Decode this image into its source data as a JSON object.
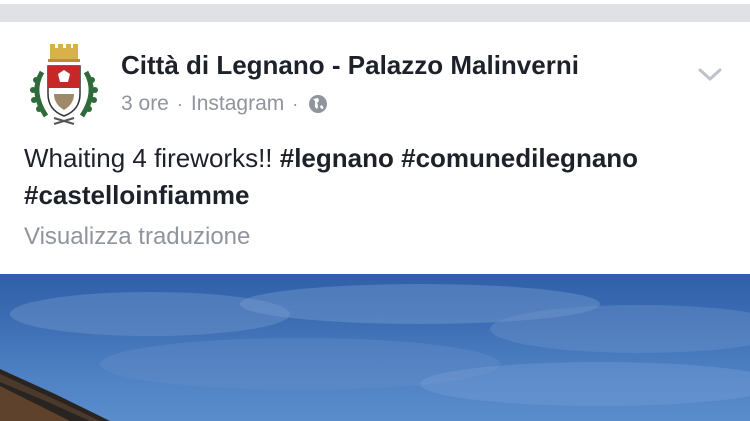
{
  "post": {
    "author": "Città di Legnano - Palazzo Malinverni",
    "time": "3 ore",
    "separator": "·",
    "source": "Instagram",
    "text_plain": "Whaiting 4 fireworks!! ",
    "hashtags": [
      "#legnano",
      "#comunedilegnano",
      "#castelloinfiamme"
    ],
    "translate_link": "Visualizza traduzione"
  },
  "icons": {
    "avatar": "city-coat-of-arms-icon",
    "audience": "globe-icon",
    "menu": "chevron-down-icon"
  },
  "colors": {
    "author": "#1d2129",
    "meta": "#90949c",
    "divider": "#e0e1e5",
    "sky": "#3e6fb5"
  }
}
